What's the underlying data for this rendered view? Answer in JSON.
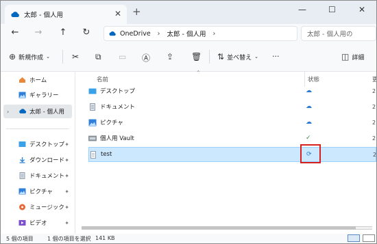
{
  "window": {
    "tab_title": "太郎 - 個人用",
    "tab_close": "✕",
    "new_tab": "+",
    "minimize": "—",
    "maximize": "☐",
    "close": "✕"
  },
  "nav": {
    "back": "←",
    "forward": "→",
    "up": "↑",
    "refresh": "↻",
    "breadcrumb": [
      "OneDrive",
      "太郎 - 個人用"
    ],
    "sep": "›",
    "search_placeholder": "太郎 - 個人用の"
  },
  "toolbar": {
    "new_label": "新規作成",
    "sort_label": "並べ替え",
    "more": "···",
    "details_label": "詳細"
  },
  "sidebar": {
    "top_items": [
      {
        "label": "ホーム",
        "icon": "home-icon"
      },
      {
        "label": "ギャラリー",
        "icon": "gallery-icon"
      },
      {
        "label": "太郎 - 個人用",
        "icon": "onedrive-cloud-icon",
        "selected": true
      }
    ],
    "quick_items": [
      {
        "label": "デスクトップ",
        "icon": "desktop-folder-icon"
      },
      {
        "label": "ダウンロード",
        "icon": "download-icon"
      },
      {
        "label": "ドキュメント",
        "icon": "document-icon"
      },
      {
        "label": "ピクチャ",
        "icon": "pictures-icon"
      },
      {
        "label": "ミュージック",
        "icon": "music-icon"
      },
      {
        "label": "ビデオ",
        "icon": "video-icon"
      }
    ],
    "pin": "📌"
  },
  "list": {
    "col_name": "名前",
    "col_status": "状態",
    "col_date": "更",
    "rows": [
      {
        "name": "デスクトップ",
        "icon": "desktop-folder-icon",
        "status": "☁",
        "date": "2"
      },
      {
        "name": "ドキュメント",
        "icon": "document-icon",
        "status": "☁",
        "date": "2"
      },
      {
        "name": "ピクチャ",
        "icon": "pictures-icon",
        "status": "☁",
        "date": "2"
      },
      {
        "name": "個人用 Vault",
        "icon": "vault-icon",
        "status": "✓",
        "date": "2"
      },
      {
        "name": "test",
        "icon": "text-file-icon",
        "status": "⟳",
        "date": "2",
        "selected": true
      }
    ]
  },
  "status": {
    "count": "5 個の項目",
    "selection": "1 個の項目を選択",
    "size": "141 KB"
  },
  "colors": {
    "accent": "#0067c0",
    "selection": "#cce8ff",
    "sync_highlight": "#d62020",
    "sync_icon": "#2b7ad6",
    "ok_green": "#2e8b3d"
  }
}
